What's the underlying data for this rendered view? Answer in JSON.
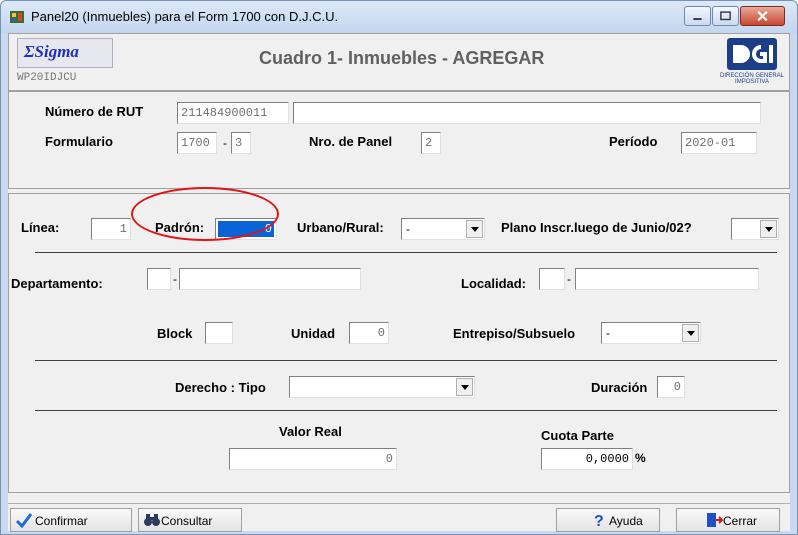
{
  "window": {
    "title": "Panel20 (Inmuebles) para el Form 1700 con D.J.C.U."
  },
  "header": {
    "sigma_logo": "ΣSigma",
    "form_code": "WP20IDJCU",
    "main_title": "Cuadro 1- Inmuebles - AGREGAR",
    "dgi_subtext": "DIRECCIÓN GENERAL IMPOSITIVA"
  },
  "identification": {
    "rut_label": "Número de RUT",
    "rut_value": "211484900011",
    "rut_name_value": "",
    "formulario_label": "Formulario",
    "formulario_value": "1700",
    "formulario_dash": "-",
    "formulario_version": "3",
    "panel_label": "Nro. de Panel",
    "panel_value": "2",
    "periodo_label": "Período",
    "periodo_value": "2020-01"
  },
  "main": {
    "linea_label": "Línea:",
    "linea_value": "1",
    "padron_label": "Padrón:",
    "padron_value": "0",
    "urbano_label": "Urbano/Rural:",
    "urbano_value": "-",
    "plano_label": "Plano Inscr.luego de Junio/02?",
    "plano_value": "",
    "departamento_label": "Departamento:",
    "departamento_code": "",
    "departamento_dash": "-",
    "departamento_name": "",
    "localidad_label": "Localidad:",
    "localidad_code": "",
    "localidad_dash": "-",
    "localidad_name": "",
    "block_label": "Block",
    "block_value": "",
    "unidad_label": "Unidad",
    "unidad_value": "0",
    "entrepiso_label": "Entrepiso/Subsuelo",
    "entrepiso_value": "-",
    "derecho_label": "Derecho :  Tipo",
    "derecho_value": "",
    "duracion_label": "Duración",
    "duracion_value": "0",
    "valor_label": "Valor Real",
    "valor_value": "0",
    "cuota_label": "Cuota Parte",
    "cuota_value": "0,0000",
    "cuota_unit": "%"
  },
  "toolbar": {
    "confirmar": "Confirmar",
    "consultar": "Consultar",
    "ayuda": "Ayuda",
    "cerrar": "Cerrar"
  },
  "colors": {
    "selection": "#0a64d8",
    "highlight_ring": "#e01515",
    "title_text": "#606060",
    "dgi_blue": "#1a3f86"
  }
}
